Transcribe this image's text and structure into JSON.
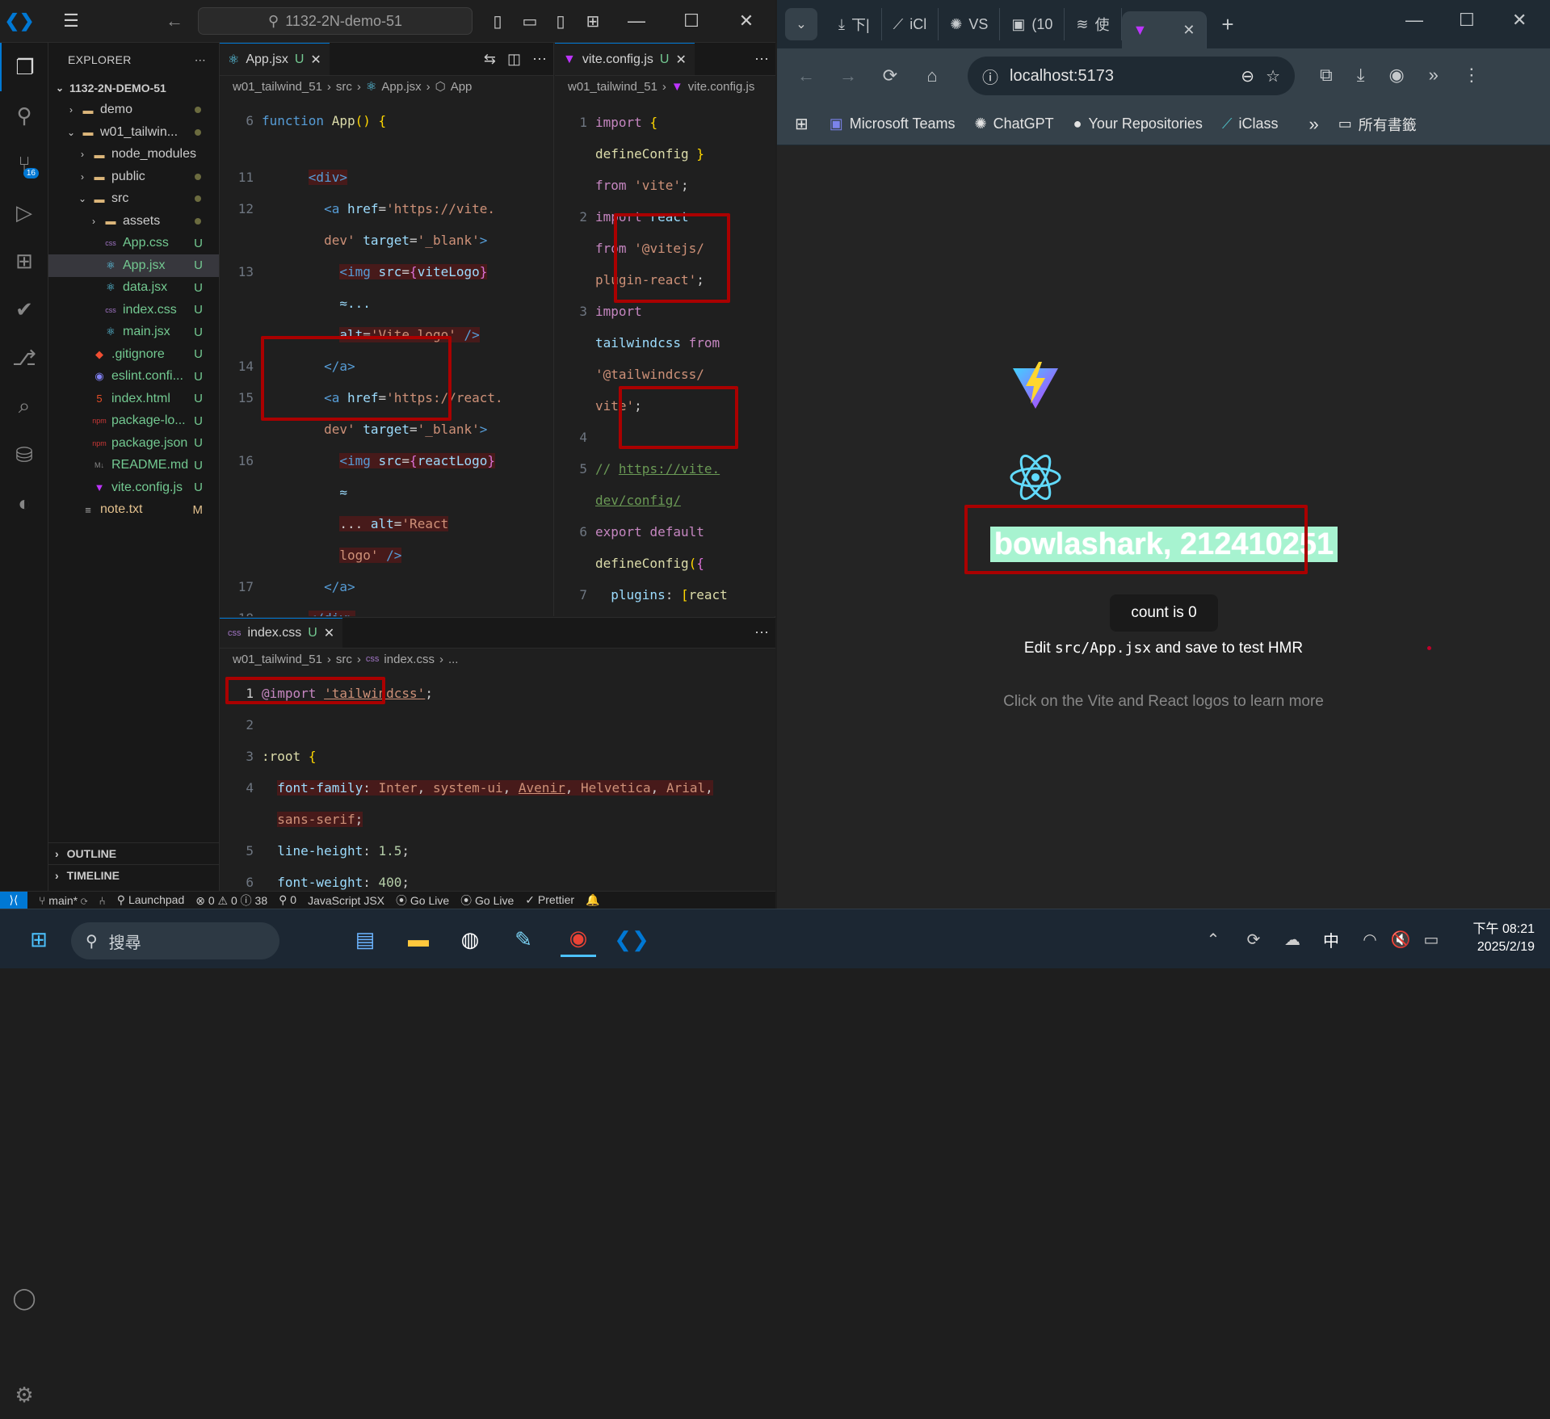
{
  "vscode": {
    "search_text": "1132-2N-demo-51",
    "explorer": {
      "title": "EXPLORER",
      "root": "1132-2N-DEMO-51",
      "items": [
        {
          "label": "demo",
          "status": "dot",
          "indent": 1,
          "type": "folder",
          "chev": "›"
        },
        {
          "label": "w01_tailwin...",
          "status": "dot",
          "indent": 1,
          "type": "folder",
          "chev": "⌄"
        },
        {
          "label": "node_modules",
          "status": "",
          "indent": 2,
          "type": "folder",
          "chev": "›"
        },
        {
          "label": "public",
          "status": "dot",
          "indent": 2,
          "type": "folder",
          "chev": "›"
        },
        {
          "label": "src",
          "status": "dot",
          "indent": 2,
          "type": "folder",
          "chev": "⌄"
        },
        {
          "label": "assets",
          "status": "dot",
          "indent": 3,
          "type": "folder",
          "chev": "›"
        },
        {
          "label": "App.css",
          "status": "U",
          "indent": 3,
          "type": "css"
        },
        {
          "label": "App.jsx",
          "status": "U",
          "indent": 3,
          "type": "react",
          "selected": true
        },
        {
          "label": "data.jsx",
          "status": "U",
          "indent": 3,
          "type": "react"
        },
        {
          "label": "index.css",
          "status": "U",
          "indent": 3,
          "type": "css"
        },
        {
          "label": "main.jsx",
          "status": "U",
          "indent": 3,
          "type": "react"
        },
        {
          "label": ".gitignore",
          "status": "U",
          "indent": 2,
          "type": "git"
        },
        {
          "label": "eslint.confi...",
          "status": "U",
          "indent": 2,
          "type": "eslint"
        },
        {
          "label": "index.html",
          "status": "U",
          "indent": 2,
          "type": "html"
        },
        {
          "label": "package-lo...",
          "status": "U",
          "indent": 2,
          "type": "npm"
        },
        {
          "label": "package.json",
          "status": "U",
          "indent": 2,
          "type": "npm"
        },
        {
          "label": "README.md",
          "status": "U",
          "indent": 2,
          "type": "md"
        },
        {
          "label": "vite.config.js",
          "status": "U",
          "indent": 2,
          "type": "vite"
        },
        {
          "label": "note.txt",
          "status": "M",
          "indent": 1,
          "type": "txt"
        }
      ],
      "outline": "OUTLINE",
      "timeline": "TIMELINE"
    },
    "source_control_badge": "16",
    "editor1": {
      "tab": "App.jsx",
      "tab_status": "U",
      "breadcrumb": [
        "w01_tailwind_51",
        "src",
        "App.jsx",
        "App"
      ]
    },
    "editor2": {
      "tab": "vite.config.js",
      "tab_status": "U",
      "breadcrumb": [
        "w01_tailwind_51",
        "vite.config.js"
      ]
    },
    "editor3": {
      "tab": "index.css",
      "tab_status": "U",
      "breadcrumb": [
        "w01_tailwind_51",
        "src",
        "index.css",
        "..."
      ]
    },
    "status": {
      "branch": "main*",
      "launchpad": "Launchpad",
      "problems": "⊗ 0 ⚠ 0 ⓘ 38",
      "ports": "0",
      "language": "JavaScript JSX",
      "golive1": "Go Live",
      "golive2": "Go Live",
      "prettier": "Prettier"
    }
  },
  "browser": {
    "tabs": [
      "下|",
      "iCl",
      "VS",
      "(10",
      "使"
    ],
    "url": "localhost:5173",
    "bookmarks": [
      "Microsoft Teams",
      "ChatGPT",
      "Your Repositories",
      "iClass"
    ],
    "all_bookmarks": "所有書籤",
    "page": {
      "name_line": "bowlashark, 212410251",
      "count_button": "count is 0",
      "edit_prefix": "Edit ",
      "edit_code": "src/App.jsx",
      "edit_suffix": " and save to test HMR",
      "learn_more": "Click on the Vite and React logos to learn more"
    }
  },
  "taskbar": {
    "search": "搜尋",
    "time": "下午 08:21",
    "date": "2025/2/19",
    "ime": "中"
  }
}
